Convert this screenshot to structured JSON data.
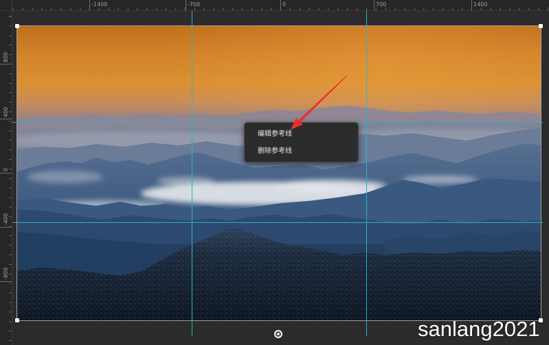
{
  "rulers": {
    "top_labels": [
      "-1400",
      "-700",
      "0",
      "700",
      "1400"
    ],
    "left_labels": [
      "800",
      "400",
      "0",
      "-400",
      "-800"
    ]
  },
  "context_menu": {
    "items": [
      {
        "label": "编辑参考线"
      },
      {
        "label": "删除参考线"
      }
    ]
  },
  "watermark": "sanlang2021",
  "icons": {
    "rotate_handle": "rotate-handle-icon",
    "corner_handle": "resize-handle-icon",
    "annotation": "red-arrow-icon"
  },
  "colors": {
    "guide_line": "#2ab3c5",
    "annotation_arrow": "#e8312a"
  }
}
